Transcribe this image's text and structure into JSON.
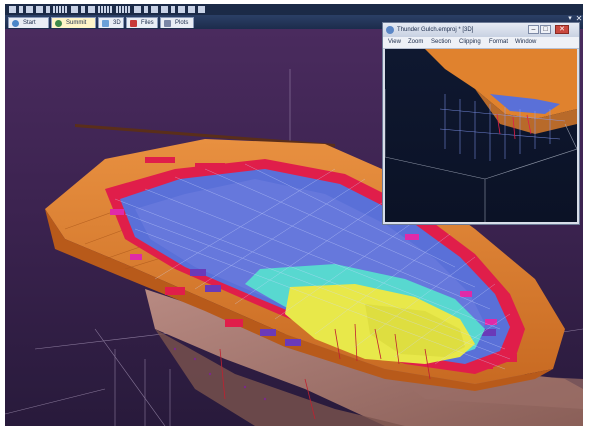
{
  "tabs": [
    {
      "label": "Start",
      "icon": "globe-icon",
      "color": "#4a86c8",
      "active": false
    },
    {
      "label": "Summit",
      "icon": "mountain-icon",
      "color": "#3e8a4a",
      "active": true
    },
    {
      "label": "3D",
      "icon": "cube-3d-icon",
      "color": "#6aa0d8",
      "active": false
    },
    {
      "label": "Files",
      "icon": "files-icon",
      "color": "#c83a3a",
      "active": false
    },
    {
      "label": "Plots",
      "icon": "plots-icon",
      "color": "#7a86a6",
      "active": false
    }
  ],
  "subwindow": {
    "title": "Thunder Gulch.emproj * [3D]",
    "menu": [
      "View",
      "Zoom",
      "Section",
      "Clipping",
      "Format",
      "Window"
    ]
  },
  "colors": {
    "background_top": "#4a2b5e",
    "background_bottom": "#281a3b",
    "surface_orange": "#e0822e",
    "block_blue": "#5a70d8",
    "block_red": "#e01e4a",
    "block_magenta": "#e02aa8",
    "block_cyan": "#58d8d0",
    "block_yellow": "#e8e84a",
    "block_purple": "#6a3ab8",
    "rock_tan": "#a87a70"
  }
}
